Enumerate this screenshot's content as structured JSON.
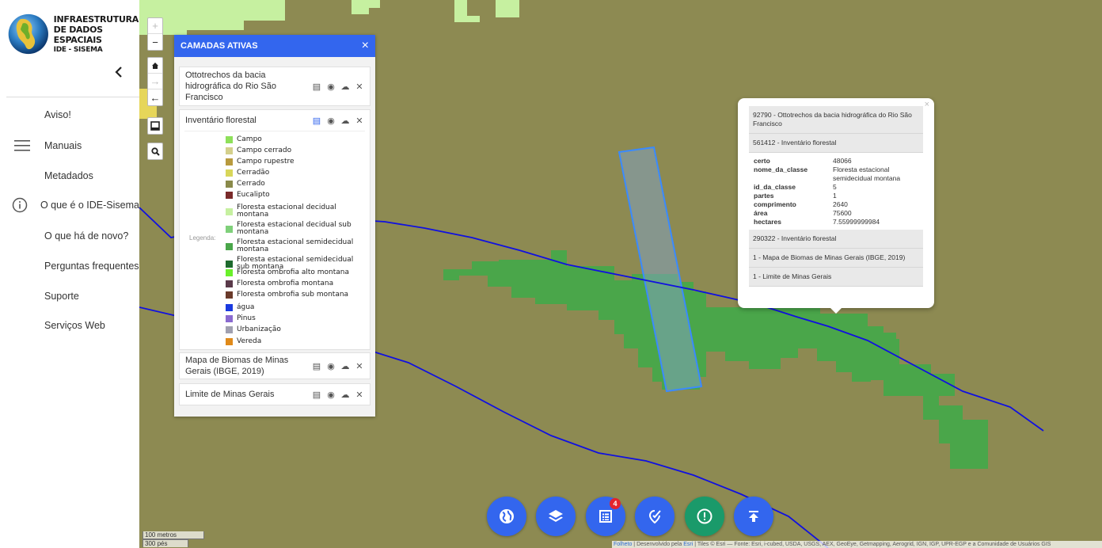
{
  "app": {
    "logo_line1": "INFRAESTRUTURA",
    "logo_line2": "DE DADOS ESPACIAIS",
    "logo_line3": "IDE - SISEMA",
    "collapse_icon": "chevron-left-icon"
  },
  "sidebar": {
    "items": [
      {
        "label": "Aviso!",
        "icon": ""
      },
      {
        "label": "Manuais",
        "icon": "hamburger-icon"
      },
      {
        "label": "Metadados",
        "icon": ""
      },
      {
        "label": "O que é o IDE-Sisema",
        "icon": "info-icon"
      },
      {
        "label": "O que há de novo?",
        "icon": ""
      },
      {
        "label": "Perguntas frequentes",
        "icon": ""
      },
      {
        "label": "Suporte",
        "icon": ""
      },
      {
        "label": "Serviços Web",
        "icon": ""
      }
    ]
  },
  "map_controls": {
    "zoom_in": "+",
    "zoom_out": "−",
    "home": "⌂",
    "forward": "→",
    "back": "←"
  },
  "layers_panel": {
    "title": "CAMADAS ATIVAS",
    "close": "×",
    "layers": [
      {
        "title": "Ottotrechos da bacia hidrográfica do Rio São Francisco"
      },
      {
        "title": "Inventário florestal"
      },
      {
        "title": "Mapa de Biomas de Minas Gerais (IBGE, 2019)"
      },
      {
        "title": "Limite de Minas Gerais"
      }
    ],
    "legend_label": "Legenda:",
    "legend": [
      {
        "label": "Campo",
        "color": "#8ee05a"
      },
      {
        "label": "Campo cerrado",
        "color": "#d4d08c"
      },
      {
        "label": "Campo rupestre",
        "color": "#b89a3e"
      },
      {
        "label": "Cerradão",
        "color": "#d8d65a"
      },
      {
        "label": "Cerrado",
        "color": "#8a8a4a"
      },
      {
        "label": "Eucalipto",
        "color": "#7a2a2a"
      },
      {
        "label": "Floresta estacional decidual montana",
        "color": "#c6f0a0"
      },
      {
        "label": "Floresta estacional decidual sub montana",
        "color": "#7fd07a"
      },
      {
        "label": "Floresta estacional semidecidual montana",
        "color": "#4aa64a"
      },
      {
        "label": "Floresta estacional semidecidual sub montana",
        "color": "#1e6a2e"
      },
      {
        "label": "Floresta ombrofia alto montana",
        "color": "#6af02a"
      },
      {
        "label": "Floresta ombrofia montana",
        "color": "#5a3a4a"
      },
      {
        "label": "Floresta ombrofia sub montana",
        "color": "#6a3a2a"
      },
      {
        "label": "água",
        "color": "#1a3ae0"
      },
      {
        "label": "Pinus",
        "color": "#8a6ad0"
      },
      {
        "label": "Urbanização",
        "color": "#a0a0b0"
      },
      {
        "label": "Vereda",
        "color": "#e08a1a"
      }
    ]
  },
  "popup": {
    "close": "×",
    "section1": "92790 - Ottotrechos da bacia hidrográfica do Rio São Francisco",
    "section2": "561412 - Inventário florestal",
    "attributes": [
      {
        "key": "certo",
        "value": "48066"
      },
      {
        "key": "nome_da_classe",
        "value": "Floresta estacional semidecidual montana"
      },
      {
        "key": "id_da_classe",
        "value": "5"
      },
      {
        "key": "partes",
        "value": "1"
      },
      {
        "key": "comprimento",
        "value": "2640"
      },
      {
        "key": "área",
        "value": "75600"
      },
      {
        "key": "hectares",
        "value": "7.55999999984"
      }
    ],
    "section3": "290322 - Inventário florestal",
    "section4": "1 - Mapa de Biomas de Minas Gerais (IBGE, 2019)",
    "section5": "1 - Limite de Minas Gerais"
  },
  "toolbar": {
    "badge_count": "4"
  },
  "scale": {
    "metric": "100 metros",
    "imperial": "300 pés"
  },
  "attribution": {
    "leaflet": "Folheto",
    "dev": " | Desenvolvido pela ",
    "esri": "Esri",
    "rest": " | Tiles © Esri — Fonte: Esri, i-cubed, USDA, USGS, AEX, GeoEye, Getmapping, Aerogrid, IGN, IGP, UPR-EGP e a Comunidade de Usuários GIS"
  },
  "colors": {
    "accent": "#3366ee",
    "map_bg": "#8d8a52",
    "forest": "#4aa64a",
    "river": "#1010e0",
    "badge": "#e4232d"
  }
}
